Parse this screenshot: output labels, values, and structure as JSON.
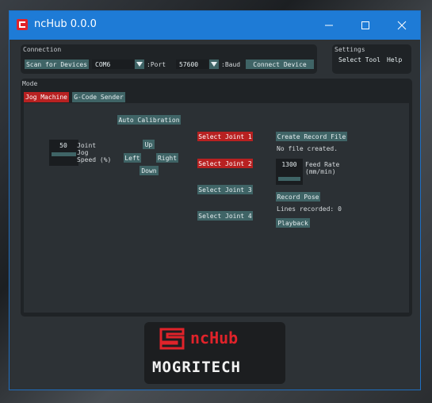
{
  "window": {
    "title": "ncHub 0.0.0"
  },
  "connection": {
    "label": "Connection",
    "scan_button": "Scan for Devices",
    "port_value": "COM6",
    "port_label": ":Port",
    "baud_value": "57600",
    "baud_label": ":Baud",
    "connect_button": "Connect Device"
  },
  "settings": {
    "label": "Settings",
    "menu": [
      "Select Tool",
      "Help"
    ]
  },
  "mode": {
    "label": "Mode",
    "tabs": [
      "Jog Machine",
      "G-Code Sender"
    ]
  },
  "jog": {
    "auto_calibration": "Auto Calibration",
    "speed_value": "50",
    "speed_label_1": "Joint",
    "speed_label_2": "Jog",
    "speed_label_3": "Speed (%)",
    "up": "Up",
    "left": "Left",
    "right": "Right",
    "down": "Down",
    "joints": [
      "Select Joint 1",
      "Select Joint 2",
      "Select Joint 3",
      "Select Joint 4"
    ]
  },
  "record": {
    "create_button": "Create Record File",
    "file_status": "No file created.",
    "feed_value": "1300",
    "feed_label_1": "Feed Rate",
    "feed_label_2": "(mm/min)",
    "record_pose": "Record Pose",
    "lines_recorded": "Lines recorded: 0",
    "playback": "Playback"
  },
  "logo": {
    "brand": "ncHub",
    "company": "MOGRITECH"
  },
  "colors": {
    "accent_red": "#b82121",
    "button_teal": "#3f6466",
    "titlebar_blue": "#1e7bd6"
  }
}
